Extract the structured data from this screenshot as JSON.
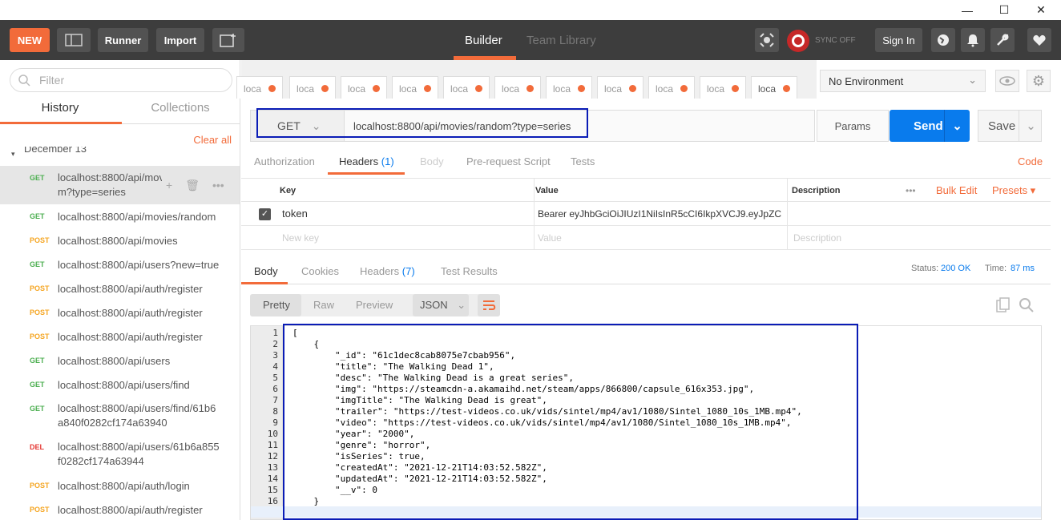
{
  "window": {
    "minimize": "—",
    "maximize": "☐",
    "close": "✕"
  },
  "toolbar": {
    "new_label": "NEW",
    "runner_label": "Runner",
    "import_label": "Import",
    "builder_tab": "Builder",
    "team_library_tab": "Team Library",
    "sync_label": "SYNC OFF",
    "signin_label": "Sign In"
  },
  "sidebar": {
    "filter_placeholder": "Filter",
    "tabs": [
      "History",
      "Collections"
    ],
    "clear_all": "Clear all",
    "group_label": "December 13",
    "items": [
      {
        "method": "GET",
        "line1": "localhost:8800/api/mo​vies/rando",
        "line2": "m?type=series"
      },
      {
        "method": "GET",
        "line1": "localhost:8800/api/movies/random"
      },
      {
        "method": "POST",
        "line1": "localhost:8800/api/movies"
      },
      {
        "method": "GET",
        "line1": "localhost:8800/api/users?new=true"
      },
      {
        "method": "POST",
        "line1": "localhost:8800/api/auth/register"
      },
      {
        "method": "POST",
        "line1": "localhost:8800/api/auth/register"
      },
      {
        "method": "POST",
        "line1": "localhost:8800/api/auth/register"
      },
      {
        "method": "GET",
        "line1": "localhost:8800/api/users"
      },
      {
        "method": "GET",
        "line1": "localhost:8800/api/users/find"
      },
      {
        "method": "GET",
        "line1": "localhost:8800/api/users/find/61b6",
        "line2": "a840f0282cf174a63940"
      },
      {
        "method": "DEL",
        "line1": "localhost:8800/api/users/61b6a855",
        "line2": "f0282cf174a63944"
      },
      {
        "method": "POST",
        "line1": "localhost:8800/api/auth/login"
      },
      {
        "method": "POST",
        "line1": "localhost:8800/api/auth/register"
      }
    ]
  },
  "request_tabs": [
    "loca",
    "loca",
    "loca",
    "loca",
    "loca",
    "loca",
    "loca",
    "loca",
    "loca",
    "loca",
    "loca"
  ],
  "environment": "No Environment",
  "request": {
    "method": "GET",
    "url": "localhost:8800/api/movies/random?type=series",
    "params_label": "Params",
    "send_label": "Send",
    "save_label": "Save"
  },
  "req_subtabs": {
    "authorization": "Authorization",
    "headers": "Headers",
    "headers_count": "(1)",
    "body": "Body",
    "prerequest": "Pre-request Script",
    "tests": "Tests",
    "code": "Code"
  },
  "headers_table": {
    "col_key": "Key",
    "col_value": "Value",
    "col_description": "Description",
    "more": "•••",
    "bulk_edit": "Bulk Edit",
    "presets": "Presets ▾",
    "rows": [
      {
        "key": "token",
        "value": "Bearer eyJhbGciOiJIUzI1NiIsInR5cCI6IkpXVCJ9.eyJpZC..."
      }
    ],
    "new_key": "New key",
    "new_value": "Value",
    "new_description": "Description"
  },
  "response": {
    "tabs": {
      "body": "Body",
      "cookies": "Cookies",
      "headers": "Headers",
      "headers_count": "(7)",
      "test_results": "Test Results"
    },
    "status_label": "Status:",
    "status_value": "200 OK",
    "time_label": "Time:",
    "time_value": "87 ms",
    "view_modes": [
      "Pretty",
      "Raw",
      "Preview"
    ],
    "format": "JSON"
  },
  "code_lines": [
    "[",
    "    {",
    "        \"_id\": \"61c1dec8cab8075e7cbab956\",",
    "        \"title\": \"The Walking Dead 1\",",
    "        \"desc\": \"The Walking Dead is a great series\",",
    "        \"img\": \"https://steamcdn-a.akamaihd.net/steam/apps/866800/capsule_616x353.jpg\",",
    "        \"imgTitle\": \"The Walking Dead is great\",",
    "        \"trailer\": \"https://test-videos.co.uk/vids/sintel/mp4/av1/1080/Sintel_1080_10s_1MB.mp4\",",
    "        \"video\": \"https://test-videos.co.uk/vids/sintel/mp4/av1/1080/Sintel_1080_10s_1MB.mp4\",",
    "        \"year\": \"2000\",",
    "        \"genre\": \"horror\",",
    "        \"isSeries\": true,",
    "        \"createdAt\": \"2021-12-21T14:03:52.582Z\",",
    "        \"updatedAt\": \"2021-12-21T14:03:52.582Z\",",
    "        \"__v\": 0",
    "    }",
    "]"
  ],
  "line_numbers": [
    "1",
    "2",
    "3",
    "4",
    "5",
    "6",
    "7",
    "8",
    "9",
    "10",
    "11",
    "12",
    "13",
    "14",
    "15",
    "16",
    "17"
  ],
  "colors": {
    "accent": "#f26b3a",
    "send": "#097bed",
    "toolbar": "#3d3d3d",
    "highlight_box": "#0a1cb6",
    "get": "#4caf50",
    "post": "#f5a623",
    "del": "#e53935"
  }
}
